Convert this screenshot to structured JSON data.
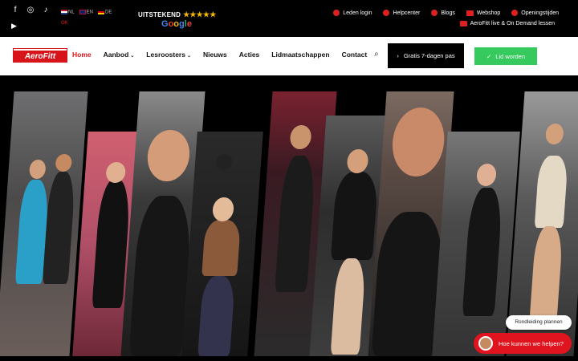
{
  "social": {
    "icons": [
      "facebook-icon",
      "instagram-icon",
      "tiktok-icon",
      "youtube-icon"
    ]
  },
  "languages": [
    {
      "code": "NL",
      "label": "NL"
    },
    {
      "code": "EN",
      "label": "EN"
    },
    {
      "code": "DE",
      "label": "DE"
    }
  ],
  "lang_ok": "OK",
  "rating": {
    "label": "UITSTEKEND",
    "stars": "★★★★★",
    "provider_g": "G",
    "provider_o1": "o",
    "provider_o2": "o",
    "provider_g2": "g",
    "provider_l": "l",
    "provider_e": "e"
  },
  "toplinks": {
    "login": "Leden login",
    "help": "Helpcenter",
    "blogs": "Blogs",
    "webshop": "Webshop",
    "hours": "Openingstijden",
    "live": "AeroFitt live & On Demand lessen"
  },
  "logo": {
    "text": "AeroFitt"
  },
  "nav": {
    "home": "Home",
    "aanbod": "Aanbod",
    "lesroosters": "Lesroosters",
    "nieuws": "Nieuws",
    "acties": "Acties",
    "lidmaatschappen": "Lidmaatschappen",
    "contact": "Contact"
  },
  "buttons": {
    "trial": "Gratis 7-dagen pas",
    "join": "Lid worden"
  },
  "widgets": {
    "tour": "Rondleiding plannen",
    "chat": "Hoe kunnen we helpen?"
  },
  "colors": {
    "brand_red": "#d7141a",
    "join_green": "#35c95e"
  }
}
